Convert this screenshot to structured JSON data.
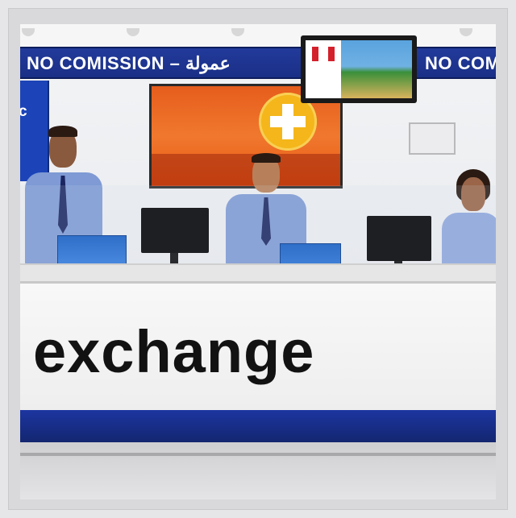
{
  "scene": {
    "banner": {
      "left_text": "NO COMISSION   –   عمولة",
      "right_text": "NO COM"
    },
    "left_panel_text": "c",
    "counter_text": "exchange",
    "colors": {
      "banner_blue": "#1e3493",
      "counter_band_blue": "#1a2f86",
      "ad_orange": "#ec6a22",
      "plus_yellow": "#f4b61a",
      "shirt_blue": "#7f9ad4"
    }
  }
}
